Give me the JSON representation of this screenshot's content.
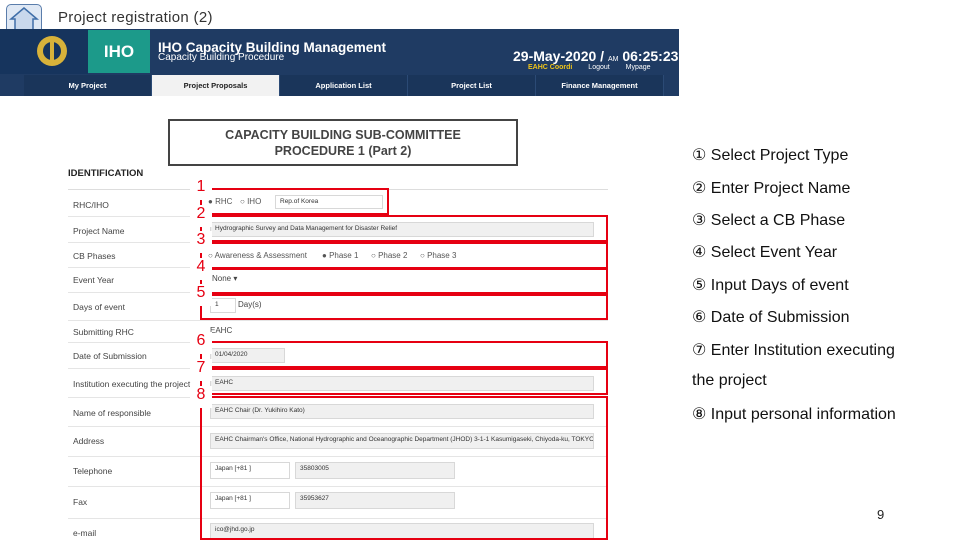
{
  "slide_title": "Project registration (2)",
  "banner": {
    "iho": "IHO",
    "title": "IHO Capacity Building Management",
    "subtitle": "Capacity Building Procedure",
    "date": "29-May-2020 /",
    "ampm": "AM",
    "time": "06:25:23",
    "user": "EAHC Coordi",
    "logout": "Logout",
    "mypage": "Mypage"
  },
  "nav": [
    "My Project",
    "Project Proposals",
    "Application List",
    "Project List",
    "Finance Management"
  ],
  "nav_active": "Project Proposals",
  "procedure_title_line1": "CAPACITY BUILDING SUB-COMMITTEE",
  "procedure_title_line2": "PROCEDURE 1 (Part 2)",
  "section_title": "IDENTIFICATION",
  "form": {
    "labels": [
      "RHC/IHO",
      "Project Name",
      "CB Phases",
      "Event Year",
      "Days of event",
      "Submitting RHC",
      "Date of Submission",
      "Institution executing the project",
      "Name of responsible",
      "Address",
      "Telephone",
      "Fax",
      "e-mail"
    ],
    "rhc_options": [
      "RHC",
      "IHO"
    ],
    "rhc_country": "Rep.of Korea",
    "project_name": "Hydrographic Survey and Data Management for Disaster Relief",
    "phases": [
      "Awareness & Assessment",
      "Phase 1",
      "Phase 2",
      "Phase 3"
    ],
    "event_year": "None ▾",
    "days_value": "1",
    "days_unit": "Day(s)",
    "submitting_rhc": "EAHC",
    "date_of_submission": "01/04/2020",
    "institution": "EAHC",
    "responsible": "EAHC Chair (Dr. Yukihiro Kato)",
    "address": "EAHC Chairman's Office, National Hydrographic and Oceanographic Department (JHOD) 3-1-1 Kasumigaseki, Chiyoda-ku, TOKYO, 1",
    "phone_country": "Japan [+81 ]",
    "telephone": "35803005",
    "fax_country": "Japan [+81 ]",
    "fax": "35953627",
    "email": "ico@jhd.go.jp"
  },
  "markers": [
    "1",
    "2",
    "3",
    "4",
    "5",
    "6",
    "7",
    "8"
  ],
  "steps": [
    "① Select Project Type",
    "② Enter Project Name",
    "③ Select a CB Phase",
    "④ Select Event Year",
    "⑤ Input Days of event",
    "⑥ Date of Submission",
    "⑦ Enter Institution executing",
    "the project",
    "⑧ Input personal information"
  ],
  "page_number": "9",
  "colors": {
    "marker_red": "#e60012",
    "banner_blue": "#1f3b63",
    "iho_teal": "#1c9a8a"
  }
}
